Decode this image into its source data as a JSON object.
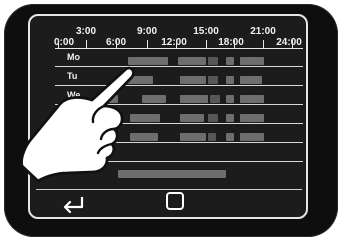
{
  "hours": [
    {
      "label": "0:00"
    },
    {
      "label": "3:00"
    },
    {
      "label": "6:00"
    },
    {
      "label": "9:00"
    },
    {
      "label": "12:00"
    },
    {
      "label": "15:00"
    },
    {
      "label": "18:00"
    },
    {
      "label": "21:00"
    },
    {
      "label": "24:00"
    }
  ],
  "days": [
    {
      "label": "Mo"
    },
    {
      "label": "Tu"
    },
    {
      "label": "We"
    }
  ],
  "icons": {
    "back": "back-arrow-icon",
    "home": "square-icon",
    "hand": "pointing-hand-icon"
  },
  "colors": {
    "screen_background": "#1c1c1c",
    "schedule_slot": "#6e6e6e",
    "device_body": "#0e0e0e"
  }
}
